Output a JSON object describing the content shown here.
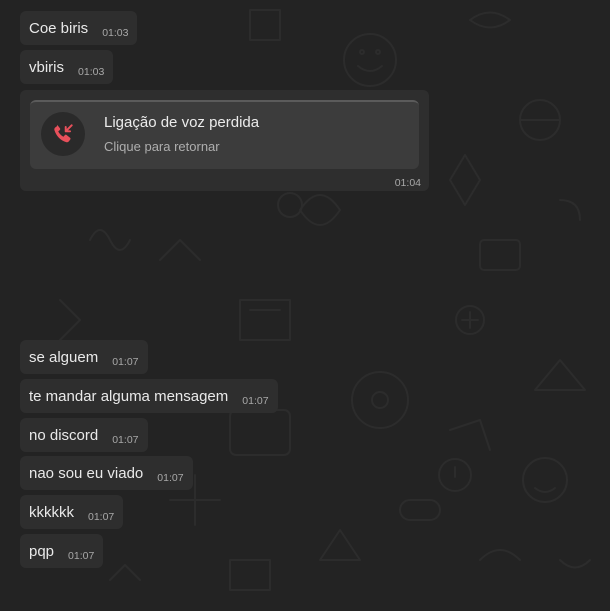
{
  "colors": {
    "background": "#232323",
    "bubble": "#2e2e2e",
    "call_card": "#3c3c3c",
    "missed_call_accent": "#e8505b",
    "text": "#e9e9e9",
    "timestamp": "#a8a8a8"
  },
  "messages_top": [
    {
      "text": "Coe biris",
      "time": "01:03"
    },
    {
      "text": "vbiris",
      "time": "01:03"
    }
  ],
  "missed_call": {
    "icon": "missed-call-icon",
    "title": "Ligação de voz perdida",
    "subtitle": "Clique para retornar",
    "time": "01:04"
  },
  "messages_bottom": [
    {
      "text": "se alguem",
      "time": "01:07"
    },
    {
      "text": "te mandar alguma mensagem",
      "time": "01:07"
    },
    {
      "text": "no discord",
      "time": "01:07"
    },
    {
      "text": "nao sou eu viado",
      "time": "01:07"
    },
    {
      "text": "kkkkkk",
      "time": "01:07"
    },
    {
      "text": "pqp",
      "time": "01:07"
    }
  ]
}
